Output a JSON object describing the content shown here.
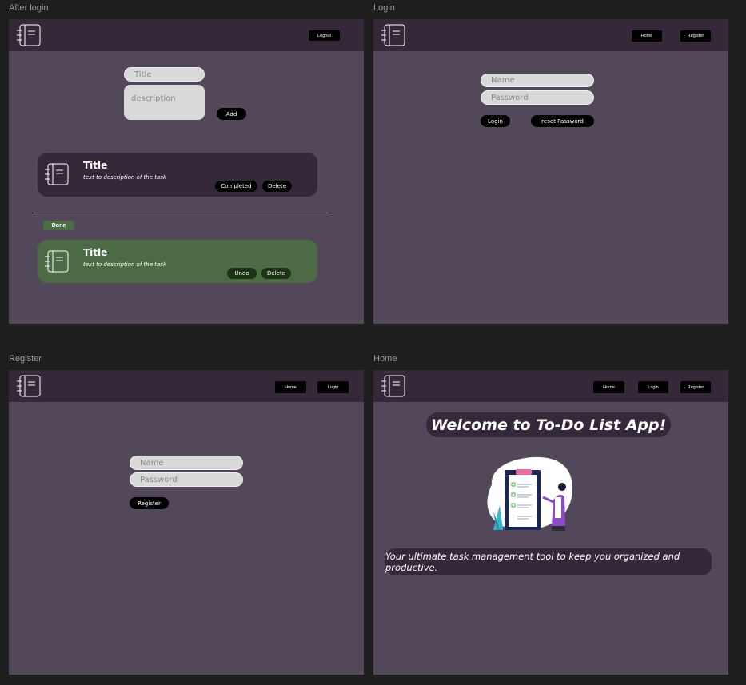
{
  "frames": {
    "after_login": {
      "label": "After login",
      "nav": {
        "logout": "Logout"
      },
      "form": {
        "title_placeholder": "Title",
        "description_placeholder": "description",
        "add_label": "Add"
      },
      "tasks": [
        {
          "title": "Title",
          "description": "text to description of the task",
          "complete_label": "Completed",
          "delete_label": "Delete"
        }
      ],
      "done_label": "Done",
      "done_tasks": [
        {
          "title": "Title",
          "description": "text to description of the task",
          "undo_label": "Undo",
          "delete_label": "Delete"
        }
      ]
    },
    "login": {
      "label": "Login",
      "nav": {
        "home": "Home",
        "register": "Register"
      },
      "form": {
        "name_placeholder": "Name",
        "password_placeholder": "Password",
        "login_label": "Login",
        "reset_label": "reset Password"
      }
    },
    "register": {
      "label": "Register",
      "nav": {
        "home": "Home",
        "login": "Login"
      },
      "form": {
        "name_placeholder": "Name",
        "password_placeholder": "Password",
        "register_label": "Register"
      }
    },
    "home": {
      "label": "Home",
      "nav": {
        "home": "Home",
        "login": "Login",
        "register": "Register"
      },
      "welcome": "Welcome to To-Do List App!",
      "tagline": "Your ultimate task management tool to keep you organized and productive."
    }
  },
  "icons": {
    "logo": "notebook-icon",
    "task": "notebook-icon"
  },
  "colors": {
    "canvas": "#1e1e1e",
    "frame_bg": "#534859",
    "navbar": "#352838",
    "task_card": "#352838",
    "done_card": "#4c6b45",
    "done_button": "#1d3315",
    "input_bg": "#d9d9d9"
  }
}
